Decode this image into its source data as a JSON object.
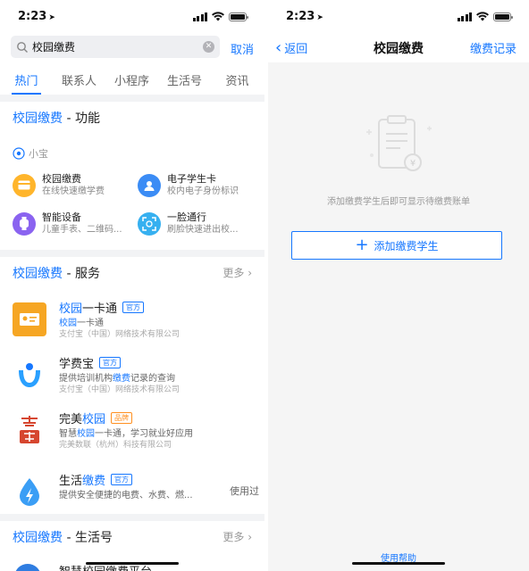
{
  "colors": {
    "accent": "#1677ff",
    "orange": "#ff8f1f",
    "red_logo": "#d6462f"
  },
  "left": {
    "time": "2:23",
    "search": {
      "value": "校园缴费",
      "cancel": "取消"
    },
    "tabs": [
      "热门",
      "联系人",
      "小程序",
      "生活号",
      "资讯"
    ],
    "active_tab": 0,
    "func_section": {
      "title_hl": "校园缴费",
      "title_rest": " - 功能",
      "assistant": "小宝"
    },
    "func_items": [
      {
        "title": "校园缴费",
        "desc": "在线快速缴学费",
        "icon": "card-icon",
        "color": "#ffb52b"
      },
      {
        "title": "电子学生卡",
        "desc": "校内电子身份标识",
        "icon": "student-icon",
        "color": "#3b8cf5"
      },
      {
        "title": "智能设备",
        "desc": "儿童手表、二维码...",
        "icon": "watch-icon",
        "color": "#8a63f0"
      },
      {
        "title": "一脸通行",
        "desc": "刷脸快速进出校...",
        "icon": "face-scan-icon",
        "color": "#36b0f0"
      }
    ],
    "service_section": {
      "title_hl": "校园缴费",
      "title_rest": " - 服务",
      "more": "更多"
    },
    "services": [
      {
        "name_hl": "校园",
        "name_rest": "一卡通",
        "badge": "官方",
        "desc": [
          "",
          "校园",
          "一卡通"
        ],
        "company": "支付宝（中国）网络技术有限公司",
        "used": ""
      },
      {
        "name_hl": "",
        "name_rest": "学费宝",
        "badge": "官方",
        "desc": [
          "提供培训机构",
          "缴费",
          "记录的查询"
        ],
        "company": "支付宝（中国）网络技术有限公司",
        "used": ""
      },
      {
        "name_hl": "校园",
        "name_rest": "完美",
        "badge": "品牌",
        "desc": [
          "智慧",
          "校园",
          "一卡通，学习就业好应用"
        ],
        "company": "完美数联（杭州）科技有限公司",
        "used": ""
      },
      {
        "name_hl": "缴费",
        "name_rest": "生活",
        "badge": "官方",
        "desc": [
          "提供安全便捷的电费、水费、燃...",
          "",
          ""
        ],
        "company": "",
        "used": "使用过"
      }
    ],
    "life_section": {
      "title_hl": "校园缴费",
      "title_rest": " - 生活号",
      "more": "更多"
    },
    "life_peek": "智慧校园缴费平台"
  },
  "right": {
    "time": "2:23",
    "back": "返回",
    "title": "校园缴费",
    "nav_right": "缴费记录",
    "empty_text": "添加缴费学生后即可显示待缴费账单",
    "add_button": "添加缴费学生",
    "help": "使用帮助"
  }
}
